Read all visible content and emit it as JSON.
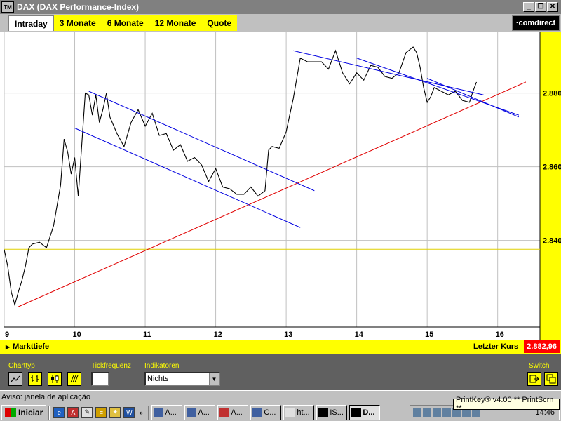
{
  "window": {
    "logo": "TM",
    "title": "DAX (DAX Performance-Index)",
    "buttons": {
      "minimize": "_",
      "restore": "❐",
      "close": "✕"
    }
  },
  "tabs": [
    {
      "label": "Intraday",
      "active": true
    },
    {
      "label": "3 Monate",
      "active": false
    },
    {
      "label": "6 Monate",
      "active": false
    },
    {
      "label": "12 Monate",
      "active": false
    },
    {
      "label": "Quote",
      "active": false
    }
  ],
  "brand": "·comdirect",
  "chart_data": {
    "type": "line",
    "title": "",
    "x_ticks": [
      "9",
      "10",
      "11",
      "12",
      "13",
      "14",
      "15",
      "16"
    ],
    "y_ticks": [
      "2.840",
      "2.860",
      "2.880"
    ],
    "xlim": [
      9,
      16.6
    ],
    "ylim": [
      2.8165,
      2.8965
    ],
    "grid": true,
    "reference_line": 2.8376,
    "series": [
      {
        "x": [
          9.0,
          9.05,
          9.1,
          9.15,
          9.2,
          9.25,
          9.3,
          9.35,
          9.4,
          9.5,
          9.6,
          9.7,
          9.8,
          9.85,
          9.9,
          9.95,
          10.0,
          10.05,
          10.1,
          10.15,
          10.2,
          10.25,
          10.3,
          10.35,
          10.4,
          10.45,
          10.5,
          10.6,
          10.7,
          10.8,
          10.9,
          11.0,
          11.1,
          11.2,
          11.3,
          11.4,
          11.5,
          11.6,
          11.7,
          11.8,
          11.9,
          12.0,
          12.1,
          12.2,
          12.3,
          12.4,
          12.5,
          12.6,
          12.7,
          12.75,
          12.8,
          12.9,
          13.0,
          13.05,
          13.1,
          13.2,
          13.3,
          13.4,
          13.5,
          13.6,
          13.7,
          13.8,
          13.9,
          14.0,
          14.1,
          14.2,
          14.3,
          14.4,
          14.5,
          14.6,
          14.7,
          14.8,
          14.85,
          14.9,
          14.95,
          15.0,
          15.05,
          15.1,
          15.2,
          15.3,
          15.4,
          15.5,
          15.6,
          15.65,
          15.7
        ],
        "y": [
          2.8375,
          2.833,
          2.826,
          2.8225,
          2.826,
          2.829,
          2.833,
          2.838,
          2.839,
          2.8395,
          2.838,
          2.844,
          2.855,
          2.8675,
          2.864,
          2.858,
          2.8625,
          2.852,
          2.866,
          2.88,
          2.8795,
          2.874,
          2.8795,
          2.872,
          2.8755,
          2.88,
          2.8735,
          2.869,
          2.8655,
          2.872,
          2.8755,
          2.871,
          2.8745,
          2.8685,
          2.869,
          2.8645,
          2.866,
          2.8615,
          2.8625,
          2.8605,
          2.856,
          2.8595,
          2.8545,
          2.854,
          2.8525,
          2.8525,
          2.8545,
          2.852,
          2.8535,
          2.8645,
          2.8655,
          2.865,
          2.8695,
          2.874,
          2.8785,
          2.8895,
          2.8885,
          2.8885,
          2.8885,
          2.8865,
          2.8915,
          2.8855,
          2.8825,
          2.8855,
          2.8835,
          2.8875,
          2.887,
          2.8845,
          2.884,
          2.8855,
          2.891,
          2.8925,
          2.891,
          2.887,
          2.8815,
          2.8775,
          2.879,
          2.8815,
          2.8805,
          2.8795,
          2.8805,
          2.878,
          2.8775,
          2.8805,
          2.883
        ]
      }
    ],
    "trendlines": [
      {
        "color": "red",
        "x": [
          9.2,
          16.4
        ],
        "y": [
          2.822,
          2.883
        ]
      },
      {
        "color": "blue",
        "x": [
          10.2,
          13.4
        ],
        "y": [
          2.8805,
          2.8535
        ]
      },
      {
        "color": "blue",
        "x": [
          10.0,
          13.2
        ],
        "y": [
          2.8705,
          2.8435
        ]
      },
      {
        "color": "blue",
        "x": [
          13.1,
          15.8
        ],
        "y": [
          2.8915,
          2.8795
        ]
      },
      {
        "color": "blue",
        "x": [
          14.0,
          16.3
        ],
        "y": [
          2.8895,
          2.874
        ]
      },
      {
        "color": "blue",
        "x": [
          15.0,
          16.3
        ],
        "y": [
          2.884,
          2.8735
        ]
      }
    ]
  },
  "infobar": {
    "left_label": "Markttiefe",
    "last_label": "Letzter Kurs",
    "last_value": "2.882,96"
  },
  "controls": {
    "charttyp_label": "Charttyp",
    "tickfrequenz_label": "Tickfrequenz",
    "indikatoren_label": "Indikatoren",
    "indikator_value": "Nichts",
    "switch_label": "Switch"
  },
  "status": {
    "text": "Aviso: janela de aplicação"
  },
  "taskbar": {
    "start": "Iniciar",
    "buttons": [
      "A...",
      "A...",
      "A...",
      "C...",
      "ht...",
      "IS...",
      "D..."
    ],
    "time": "14:46"
  },
  "tooltip": "PrintKey® v4.00 ** PrintScrn **"
}
